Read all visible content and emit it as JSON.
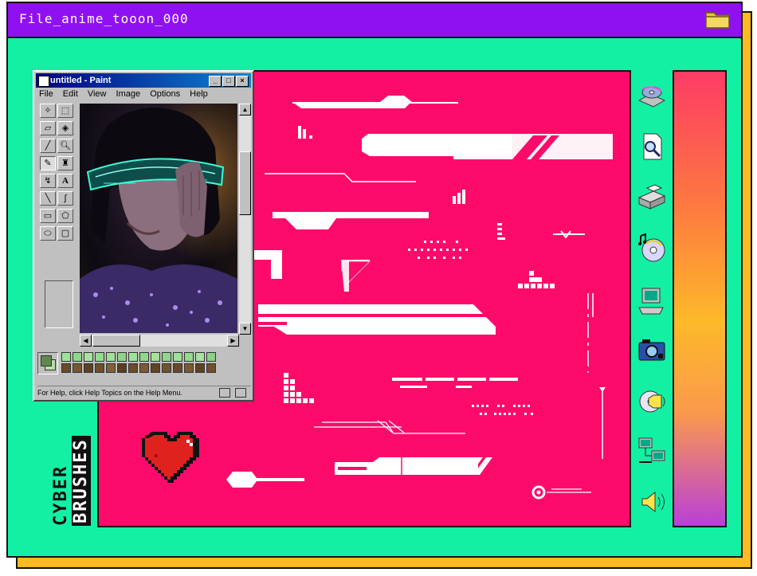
{
  "window": {
    "title": "File_anime_tooon_000",
    "icon": "folder-icon",
    "colors": {
      "frame": "#13f0a4",
      "titlebar": "#8f11f2",
      "shadow": "#fdba21",
      "canvas": "#fd0b6b"
    }
  },
  "paint": {
    "title": "untitled - Paint",
    "menu": [
      "File",
      "Edit",
      "View",
      "Image",
      "Options",
      "Help"
    ],
    "status": "For Help, click Help Topics on the Help Menu.",
    "window_buttons": [
      "_",
      "□",
      "×"
    ]
  },
  "brand": {
    "line1": "CYBER",
    "line2": "BRUSHES"
  },
  "sidebar_icons": [
    "cd-drive-icon",
    "find-document-icon",
    "printer-icon",
    "cd-audio-icon",
    "computer-icon",
    "camera-icon",
    "sound-disc-icon",
    "network-icon",
    "speaker-icon"
  ]
}
